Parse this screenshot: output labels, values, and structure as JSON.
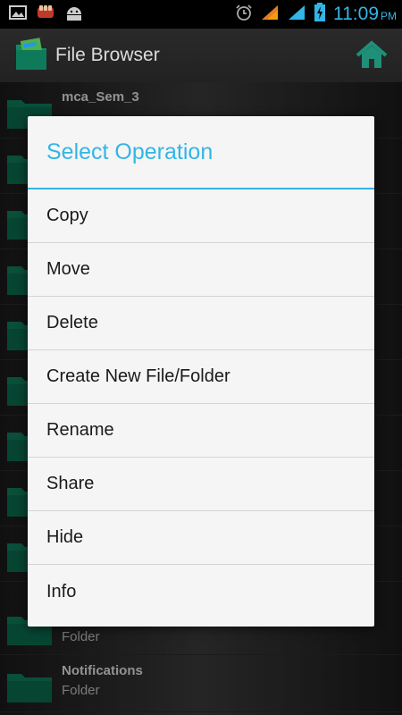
{
  "status_bar": {
    "time": "11:09",
    "ampm": "PM",
    "icons": [
      "gallery-icon",
      "fist-icon",
      "android-icon",
      "alarm-icon",
      "signal-icon",
      "signal-icon",
      "battery-charging-icon"
    ]
  },
  "action_bar": {
    "title": "File Browser",
    "app_icon": "folder-file-icon",
    "home_icon": "home-icon"
  },
  "file_list": {
    "items": [
      {
        "name": "mca_Sem_3",
        "type": ""
      },
      {
        "name": "",
        "type": "Folder"
      },
      {
        "name": "Notifications",
        "type": "Folder"
      }
    ]
  },
  "dialog": {
    "title": "Select Operation",
    "options": [
      "Copy",
      "Move",
      "Delete",
      "Create New File/Folder",
      "Rename",
      "Share",
      "Hide",
      "Info"
    ]
  },
  "colors": {
    "accent": "#33b5e5",
    "folder": "#0e7a5a",
    "dialog_bg": "#f5f5f5"
  }
}
